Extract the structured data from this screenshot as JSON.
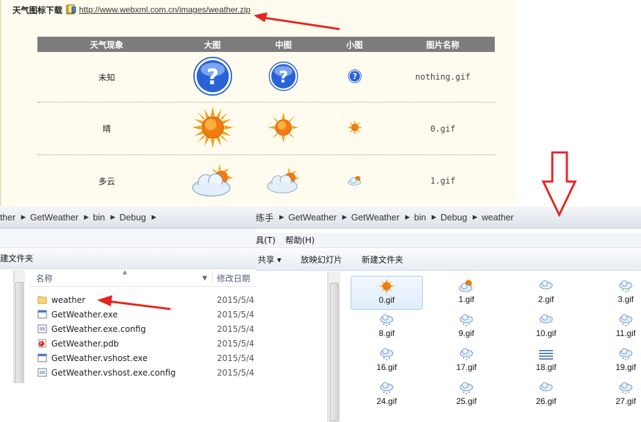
{
  "web": {
    "title": "天气图标下载",
    "link": "http://www.webxml.com.cn/images/weather.zip",
    "columns": [
      "天气现象",
      "大图",
      "中图",
      "小图",
      "图片名称"
    ],
    "rows": [
      {
        "name": "未知",
        "icon": "question-icon",
        "file": "nothing.gif"
      },
      {
        "name": "晴",
        "icon": "sun-icon",
        "file": "0.gif"
      },
      {
        "name": "多云",
        "icon": "cloudy-icon",
        "file": "1.gif"
      }
    ]
  },
  "left_window": {
    "breadcrumb": [
      "ther",
      "GetWeather",
      "bin",
      "Debug"
    ],
    "toolbar_label": "建文件夹",
    "col_name": "名称",
    "col_date": "修改日期",
    "files": [
      {
        "name": "weather",
        "date": "2015/5/4",
        "icon": "folder-icon"
      },
      {
        "name": "GetWeather.exe",
        "date": "2015/5/4",
        "icon": "exe-icon"
      },
      {
        "name": "GetWeather.exe.config",
        "date": "2015/5/4",
        "icon": "config-file-icon"
      },
      {
        "name": "GetWeather.pdb",
        "date": "2015/5/4",
        "icon": "pdb-file-icon"
      },
      {
        "name": "GetWeather.vshost.exe",
        "date": "2015/5/4",
        "icon": "exe-icon"
      },
      {
        "name": "GetWeather.vshost.exe.config",
        "date": "2015/5/4",
        "icon": "config-file-icon"
      }
    ]
  },
  "right_window": {
    "breadcrumb": [
      "练手",
      "GetWeather",
      "GetWeather",
      "bin",
      "Debug",
      "weather"
    ],
    "menu": [
      "具(T)",
      "帮助(H)"
    ],
    "toolbar": [
      "共享 ▾",
      "放映幻灯片",
      "新建文件夹"
    ],
    "gifs": [
      "0.gif",
      "1.gif",
      "2.gif",
      "3.gif",
      "8.gif",
      "9.gif",
      "10.gif",
      "11.gif",
      "16.gif",
      "17.gif",
      "18.gif",
      "19.gif",
      "24.gif",
      "25.gif",
      "26.gif",
      "27.gif"
    ]
  },
  "colors": {
    "annotation_red": "#e8231f",
    "table_header": "#7c7c7c",
    "web_bg": "#fffcef"
  }
}
